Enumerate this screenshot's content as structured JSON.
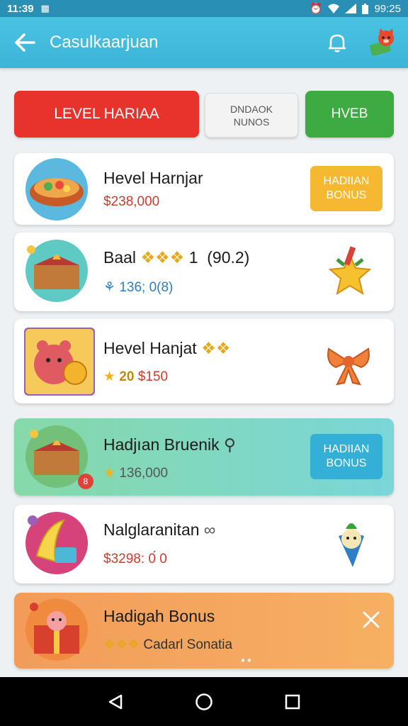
{
  "status": {
    "time": "11:39",
    "clock": "99:25"
  },
  "appbar": {
    "title": "Casulkaarjuan"
  },
  "tabs": [
    {
      "label": "LEVEL HARIAA"
    },
    {
      "label": "DNDAOK\nNUNOS"
    },
    {
      "label": "HVEB"
    }
  ],
  "cards": [
    {
      "name": "Hevel Harnjar",
      "sub": "$238,000",
      "action": "HADIIAN\nBONUS"
    },
    {
      "name": "Baal",
      "name_suffix": "1  (90.2)",
      "sub": "136; 0(8)"
    },
    {
      "name": "Hevel Hanjat",
      "sub_stars": "20",
      "sub": "$150"
    },
    {
      "name": "Hadjıan Bruenik",
      "sub": "136,000",
      "action": "HADIIAN\nBONUS",
      "badge": "8"
    },
    {
      "name": "Nalglaranitan",
      "sub": "$3298: 0́ 0"
    },
    {
      "name": "Hadigah Bonus",
      "sub": "Cadarl Sonatia"
    }
  ],
  "colors": {
    "appbar": "#3cb4d8",
    "red_tab": "#e8322c",
    "green_tab": "#3daa42",
    "bonus_yellow": "#f6b731",
    "bonus_blue": "#34afd6",
    "highlight_card": "#7fd6c4",
    "bonus_card": "#f5a65a"
  }
}
